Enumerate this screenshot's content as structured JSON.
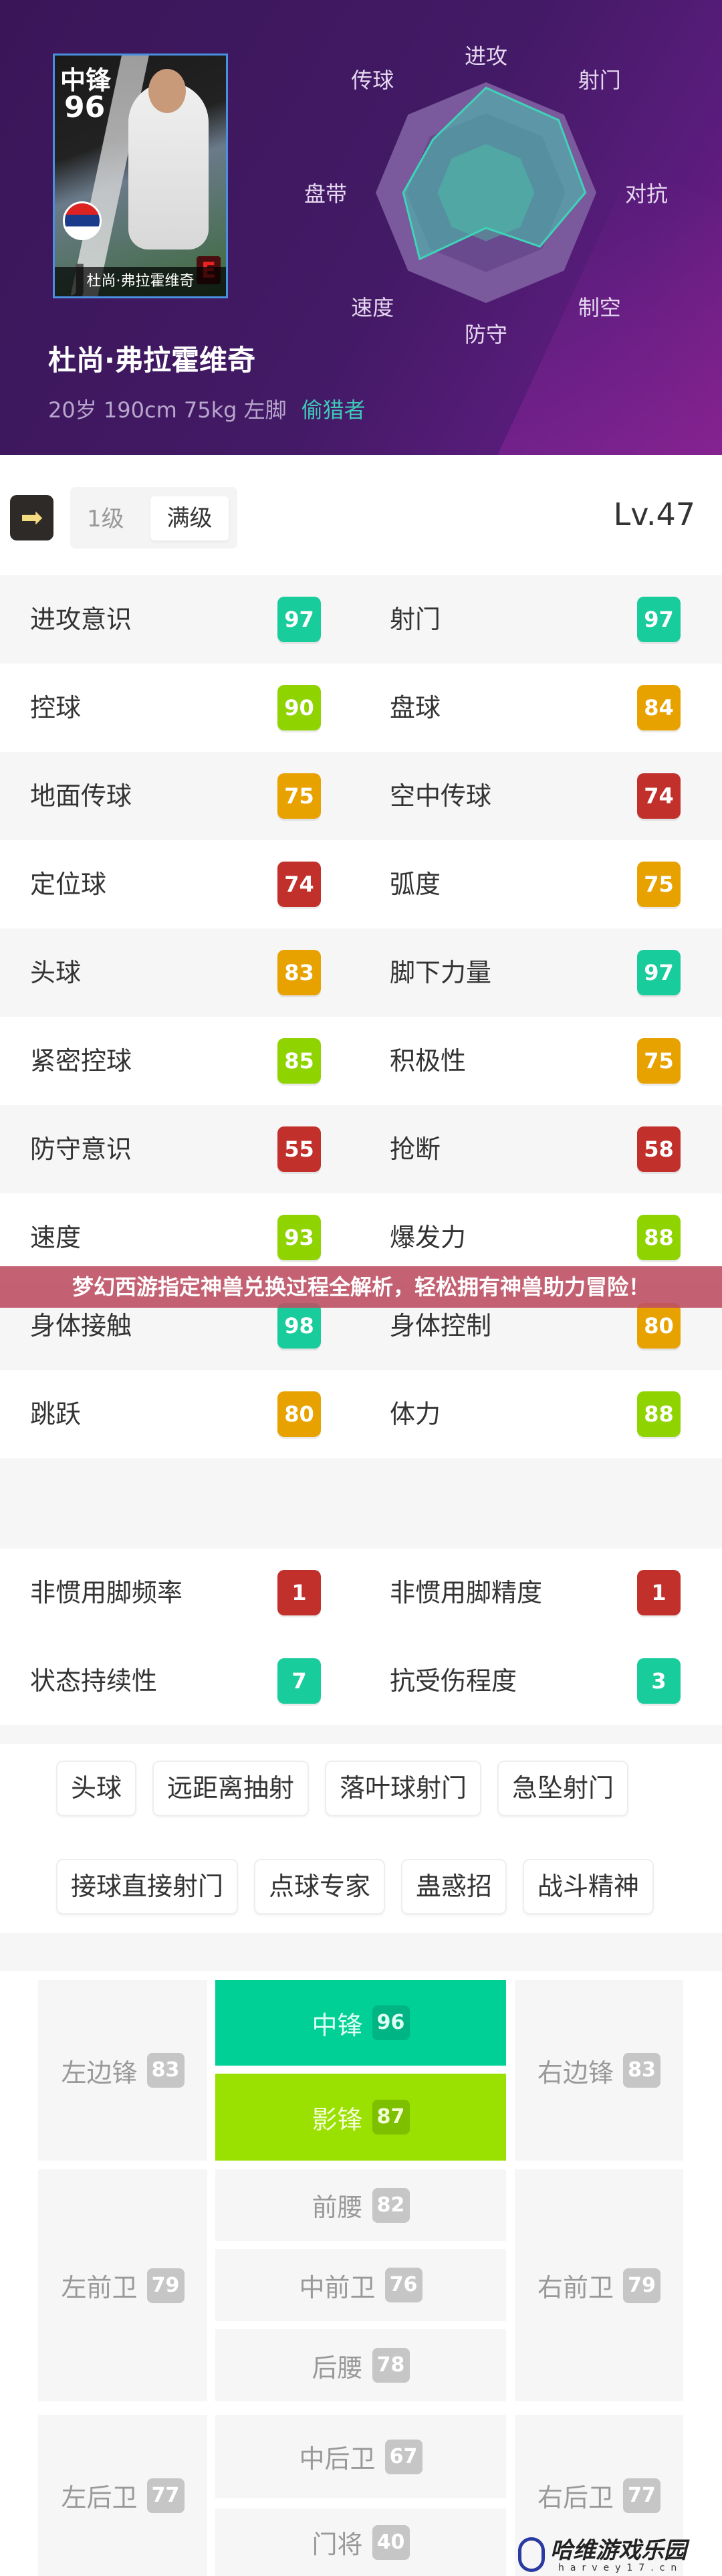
{
  "player": {
    "position": "中锋",
    "overall": "96",
    "card_name": "杜尚·弗拉霍维奇",
    "rarity": "E",
    "name": "杜尚·弗拉霍维奇",
    "info": "20岁 190cm 75kg 左脚",
    "play_style": "偷猎者"
  },
  "radar": {
    "axes": [
      "进攻",
      "射门",
      "对抗",
      "制空",
      "防守",
      "速度",
      "盘带",
      "传球"
    ],
    "values": [
      0.95,
      0.93,
      0.9,
      0.69,
      0.32,
      0.85,
      0.75,
      0.68
    ],
    "fill_color": "#3fd3b8"
  },
  "level": {
    "toggle_icon": "arrow-right-icon",
    "options": [
      "1级",
      "满级"
    ],
    "selected": "满级",
    "current": "Lv.47"
  },
  "colors": {
    "teal": "#19cc9c",
    "lime": "#8fd400",
    "orange": "#e8a200",
    "red": "#c2302c"
  },
  "stats": [
    [
      {
        "label": "进攻意识",
        "value": "97",
        "color": "teal"
      },
      {
        "label": "射门",
        "value": "97",
        "color": "teal"
      }
    ],
    [
      {
        "label": "控球",
        "value": "90",
        "color": "lime"
      },
      {
        "label": "盘球",
        "value": "84",
        "color": "orange"
      }
    ],
    [
      {
        "label": "地面传球",
        "value": "75",
        "color": "orange"
      },
      {
        "label": "空中传球",
        "value": "74",
        "color": "red"
      }
    ],
    [
      {
        "label": "定位球",
        "value": "74",
        "color": "red"
      },
      {
        "label": "弧度",
        "value": "75",
        "color": "orange"
      }
    ],
    [
      {
        "label": "头球",
        "value": "83",
        "color": "orange"
      },
      {
        "label": "脚下力量",
        "value": "97",
        "color": "teal"
      }
    ],
    [
      {
        "label": "紧密控球",
        "value": "85",
        "color": "lime"
      },
      {
        "label": "积极性",
        "value": "75",
        "color": "orange"
      }
    ],
    [
      {
        "label": "防守意识",
        "value": "55",
        "color": "red"
      },
      {
        "label": "抢断",
        "value": "58",
        "color": "red"
      }
    ],
    [
      {
        "label": "速度",
        "value": "93",
        "color": "lime"
      },
      {
        "label": "爆发力",
        "value": "88",
        "color": "lime"
      }
    ],
    [
      {
        "label": "身体接触",
        "value": "98",
        "color": "teal"
      },
      {
        "label": "身体控制",
        "value": "80",
        "color": "orange"
      }
    ],
    [
      {
        "label": "跳跃",
        "value": "80",
        "color": "orange"
      },
      {
        "label": "体力",
        "value": "88",
        "color": "lime"
      }
    ]
  ],
  "extra_stats": [
    [
      {
        "label": "非惯用脚频率",
        "value": "1",
        "color": "red"
      },
      {
        "label": "非惯用脚精度",
        "value": "1",
        "color": "red"
      }
    ],
    [
      {
        "label": "状态持续性",
        "value": "7",
        "color": "teal"
      },
      {
        "label": "抗受伤程度",
        "value": "3",
        "color": "teal"
      }
    ]
  ],
  "skills": [
    "头球",
    "远距离抽射",
    "落叶球射门",
    "急坠射门",
    "接球直接射门",
    "点球专家",
    "蛊惑招",
    "战斗精神"
  ],
  "positions": {
    "LWF": {
      "name": "左边锋",
      "value": "83"
    },
    "CF": {
      "name": "中锋",
      "value": "96",
      "bg": "#00d096",
      "badge": "#00b484"
    },
    "SS": {
      "name": "影锋",
      "value": "87",
      "bg": "#9ae000",
      "badge": "#7cc000"
    },
    "RWF": {
      "name": "右边锋",
      "value": "83"
    },
    "AMF": {
      "name": "前腰",
      "value": "82"
    },
    "LMF": {
      "name": "左前卫",
      "value": "79"
    },
    "CMF": {
      "name": "中前卫",
      "value": "76"
    },
    "RMF": {
      "name": "右前卫",
      "value": "79"
    },
    "DMF": {
      "name": "后腰",
      "value": "78"
    },
    "LB": {
      "name": "左后卫",
      "value": "77"
    },
    "CB": {
      "name": "中后卫",
      "value": "67"
    },
    "RB": {
      "name": "右后卫",
      "value": "77"
    },
    "GK": {
      "name": "门将",
      "value": "40"
    }
  },
  "banner": "梦幻西游指定神兽兑换过程全解析，轻松拥有神兽助力冒险！",
  "watermark": {
    "name": "哈维游戏乐园",
    "url": "harvey17.cn"
  }
}
